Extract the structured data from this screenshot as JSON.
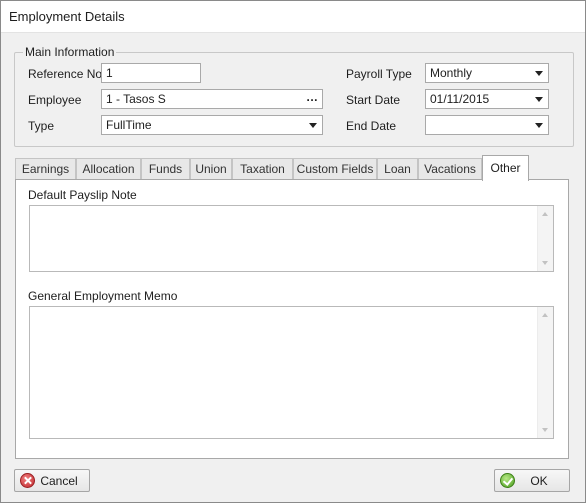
{
  "window": {
    "title": "Employment Details"
  },
  "main_info": {
    "legend": "Main Information",
    "reference_no": {
      "label": "Reference No",
      "value": "1"
    },
    "employee": {
      "label": "Employee",
      "value": "1 - Tasos S",
      "button": "..."
    },
    "type": {
      "label": "Type",
      "value": "FullTime"
    },
    "payroll_type": {
      "label": "Payroll Type",
      "value": "Monthly"
    },
    "start_date": {
      "label": "Start Date",
      "value": "01/11/2015"
    },
    "end_date": {
      "label": "End Date",
      "value": ""
    }
  },
  "tabs": [
    {
      "label": "Earnings"
    },
    {
      "label": "Allocation"
    },
    {
      "label": "Funds"
    },
    {
      "label": "Union"
    },
    {
      "label": "Taxation"
    },
    {
      "label": "Custom Fields"
    },
    {
      "label": "Loan"
    },
    {
      "label": "Vacations"
    },
    {
      "label": "Other",
      "active": true
    }
  ],
  "other_tab": {
    "payslip_note": {
      "label": "Default Payslip Note",
      "value": ""
    },
    "employment_memo": {
      "label": "General Employment Memo",
      "value": ""
    }
  },
  "buttons": {
    "cancel": "Cancel",
    "ok": "OK"
  },
  "icons": {
    "cancel": "cancel-icon",
    "ok": "ok-check-icon",
    "dropdown": "chevron-down-icon",
    "ellipsis": "ellipsis-icon"
  },
  "colors": {
    "tab_active_bg": "#ffffff",
    "window_bg": "#f0f0f0",
    "cancel_icon": "#c0282d",
    "ok_icon": "#4a9d1e"
  }
}
